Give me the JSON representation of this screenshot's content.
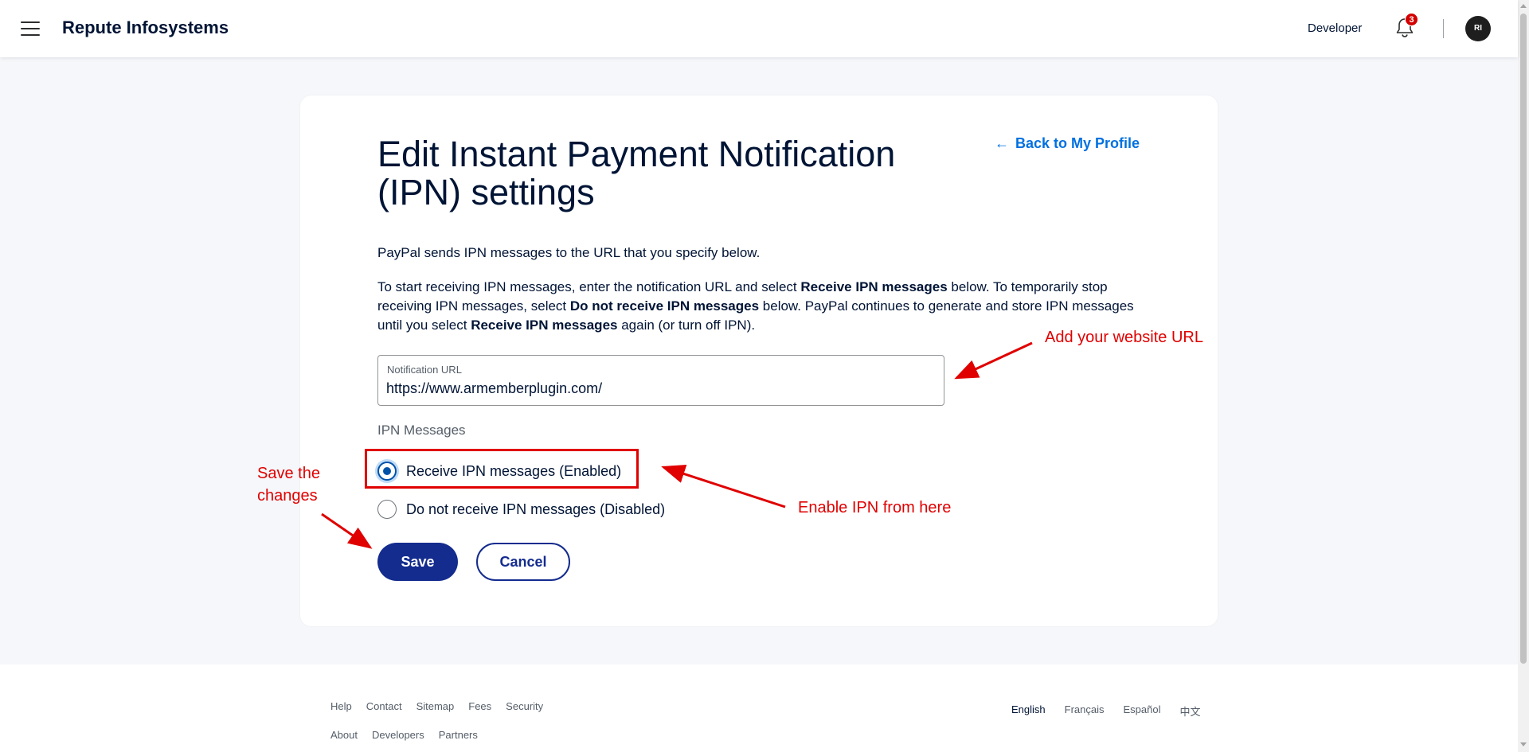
{
  "header": {
    "brand": "Repute Infosystems",
    "developer_label": "Developer",
    "notification_count": "3",
    "avatar_initials": "RI"
  },
  "main": {
    "title": "Edit Instant Payment Notification (IPN) settings",
    "back_link": "Back to My Profile",
    "intro": "PayPal sends IPN messages to the URL that you specify below.",
    "desc": {
      "t1": "To start receiving IPN messages, enter the notification URL and select ",
      "b1": "Receive IPN messages",
      "t2": " below. To temporarily stop receiving IPN messages, select ",
      "b2": "Do not receive IPN messages",
      "t3": " below. PayPal continues to generate and store IPN messages until you select ",
      "b3": "Receive IPN messages",
      "t4": " again (or turn off IPN)."
    },
    "notification_url": {
      "label": "Notification URL",
      "value": "https://www.armemberplugin.com/"
    },
    "ipn_heading": "IPN Messages",
    "options": [
      {
        "label": "Receive IPN messages (Enabled)",
        "selected": true
      },
      {
        "label": "Do not receive IPN messages (Disabled)",
        "selected": false
      }
    ],
    "save_label": "Save",
    "cancel_label": "Cancel"
  },
  "annotations": {
    "url_note": "Add your website URL",
    "enable_note": "Enable IPN from here",
    "save_note_line1": "Save the",
    "save_note_line2": "changes",
    "color": "#e00000"
  },
  "footer": {
    "links_row1": [
      "Help",
      "Contact",
      "Sitemap",
      "Fees",
      "Security"
    ],
    "links_row2": [
      "About",
      "Developers",
      "Partners"
    ],
    "languages": [
      "English",
      "Français",
      "Español",
      "中文"
    ]
  }
}
